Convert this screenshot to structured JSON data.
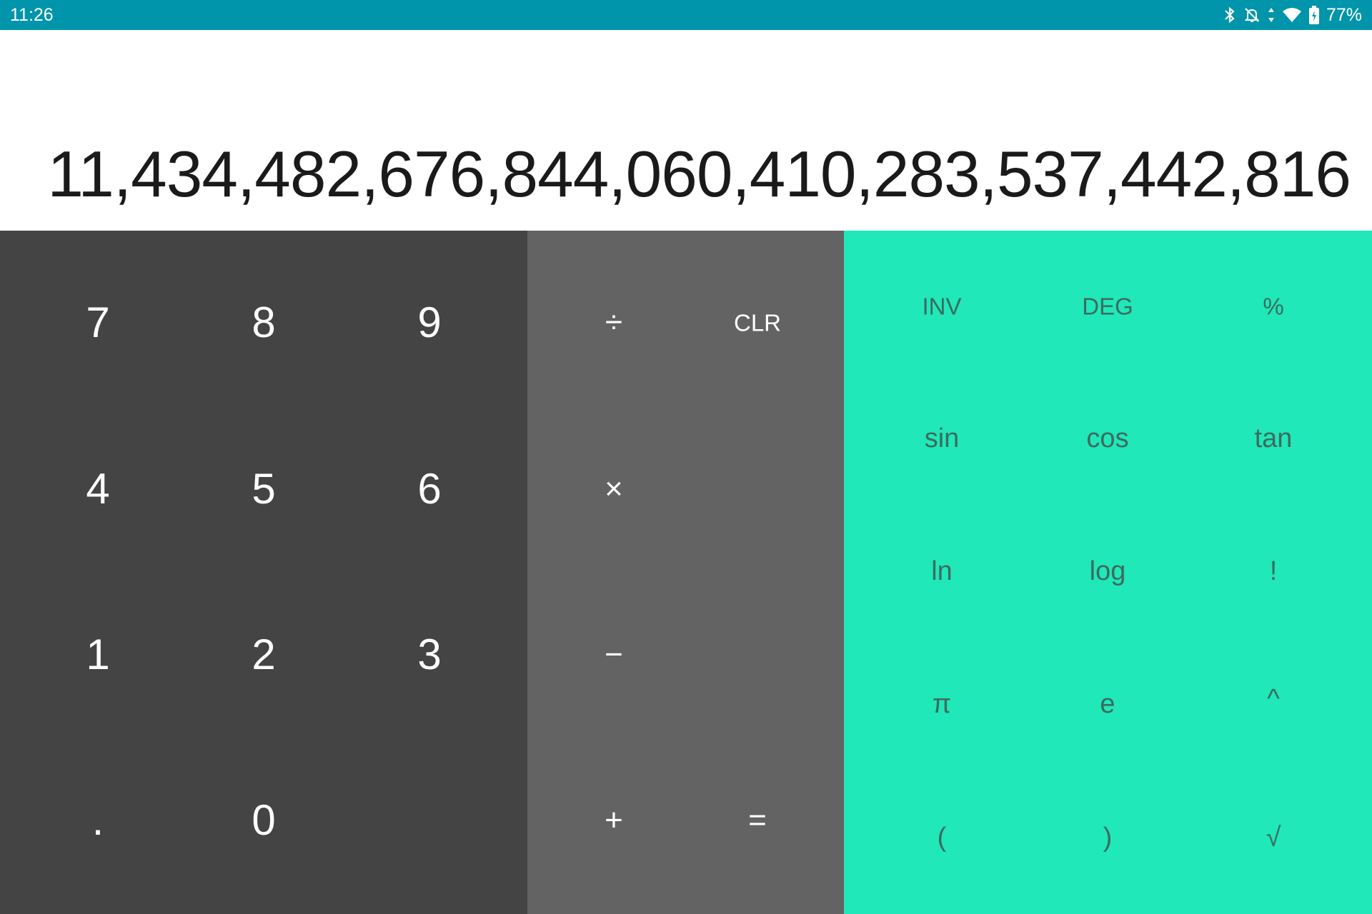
{
  "status_bar": {
    "time": "11:26",
    "battery": "77%",
    "icons": [
      "bluetooth-icon",
      "notifications-off-icon",
      "data-arrows-icon",
      "wifi-icon",
      "battery-charging-icon"
    ]
  },
  "display": {
    "result": "11,434,482,676,844,060,410,283,537,442,816"
  },
  "digit_pad": {
    "keys": [
      "7",
      "8",
      "9",
      "4",
      "5",
      "6",
      "1",
      "2",
      "3",
      ".",
      "0"
    ]
  },
  "operator_pad": {
    "divide": "÷",
    "clear": "CLR",
    "multiply": "×",
    "subtract": "−",
    "add": "+",
    "equals": "="
  },
  "advanced_pad": {
    "keys": [
      "INV",
      "DEG",
      "%",
      "sin",
      "cos",
      "tan",
      "ln",
      "log",
      "!",
      "π",
      "e",
      "^",
      "(",
      ")",
      "√"
    ]
  },
  "colors": {
    "status_bar": "#0095aa",
    "digit_pad": "#444444",
    "operator_pad": "#636363",
    "advanced_pad": "#20e8b8",
    "advanced_text": "#3d6b61"
  }
}
